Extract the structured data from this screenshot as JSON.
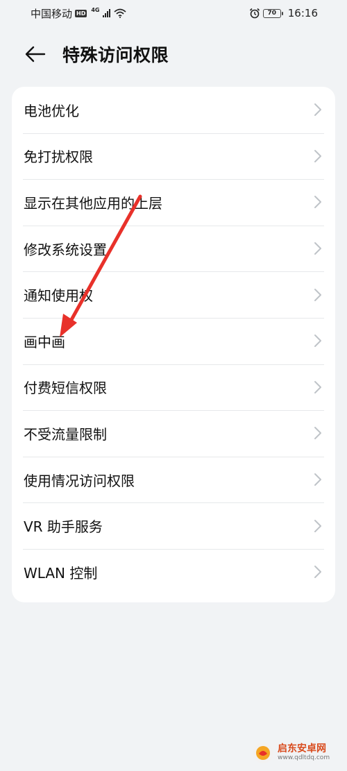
{
  "status_bar": {
    "carrier": "中国移动",
    "hd": "HD",
    "network": "4G",
    "battery": "70",
    "time": "16:16"
  },
  "header": {
    "title": "特殊访问权限"
  },
  "list": {
    "items": [
      {
        "label": "电池优化"
      },
      {
        "label": "免打扰权限"
      },
      {
        "label": "显示在其他应用的上层"
      },
      {
        "label": "修改系统设置"
      },
      {
        "label": "通知使用权"
      },
      {
        "label": "画中画"
      },
      {
        "label": "付费短信权限"
      },
      {
        "label": "不受流量限制"
      },
      {
        "label": "使用情况访问权限"
      },
      {
        "label": "VR 助手服务"
      },
      {
        "label": "WLAN 控制"
      }
    ]
  },
  "watermark": {
    "name": "启东安卓网",
    "url": "www.qdltdq.com"
  },
  "colors": {
    "background": "#f1f3f5",
    "card": "#ffffff",
    "annotation_arrow": "#e8312a",
    "chevron": "#bfc3c8"
  }
}
